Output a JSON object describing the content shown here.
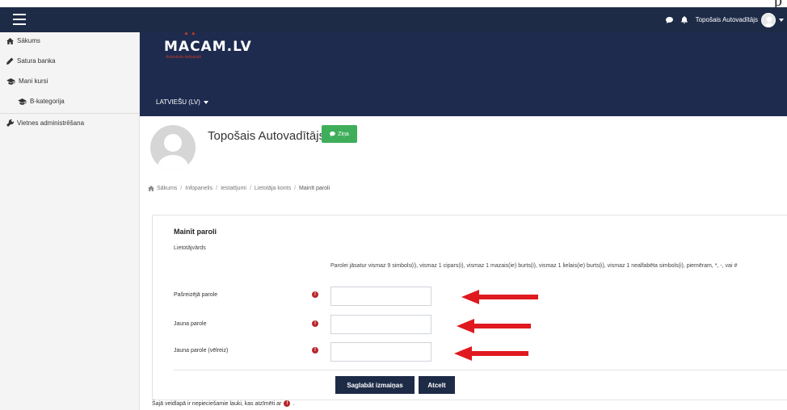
{
  "top_stray_char": "p",
  "navbar": {
    "user_name": "Topošais Autovadītājs"
  },
  "sidebar": {
    "items": [
      {
        "label": "Sākums",
        "icon": "home-icon"
      },
      {
        "label": "Satura banka",
        "icon": "pencil-icon"
      },
      {
        "label": "Mani kursi",
        "icon": "graduation-cap-icon"
      },
      {
        "label": "B-kategorija",
        "icon": "graduation-cap-icon"
      },
      {
        "label": "Vietnes administrēšana",
        "icon": "wrench-icon"
      }
    ]
  },
  "banner": {
    "logo_text": "MACAM.LV",
    "logo_tagline": "Autoskola tiešsaistē",
    "language": "LATVIEŠU (LV)"
  },
  "profile": {
    "name": "Topošais Autovadītājs",
    "message_button": "Ziņa"
  },
  "breadcrumb": [
    "Sākums",
    "Infopanelis",
    "Iestatījumi",
    "Lietotāja konts",
    "Mainīt paroli"
  ],
  "form": {
    "legend": "Mainīt paroli",
    "username_label": "Lietotājvārds",
    "password_rules": "Parolei jāsatur vismaz 9 simbols(i), vismaz 1 cipars(i), vismaz 1 mazais(ie) burts(i), vismaz 1 lielais(ie) burts(i), vismaz 1 nealfabēta simbols(i), piemēram, *, -, vai #",
    "fields": [
      {
        "label": "Pašreizējā parole",
        "value": ""
      },
      {
        "label": "Jauna parole",
        "value": ""
      },
      {
        "label": "Jauna parole (vēlreiz)",
        "value": ""
      }
    ],
    "required_glyph": "!",
    "save_button": "Saglabāt izmaiņas",
    "cancel_button": "Atcelt",
    "required_note_before": "Šajā veidlapā ir nepieciešamie lauki, kas atzīmēti ar",
    "required_note_after": "."
  },
  "colors": {
    "navbar": "#1e2b47",
    "banner": "#1e2b4f",
    "accent_green": "#3fae5a",
    "required_red": "#b7262b",
    "arrow_red": "#e0191f"
  }
}
